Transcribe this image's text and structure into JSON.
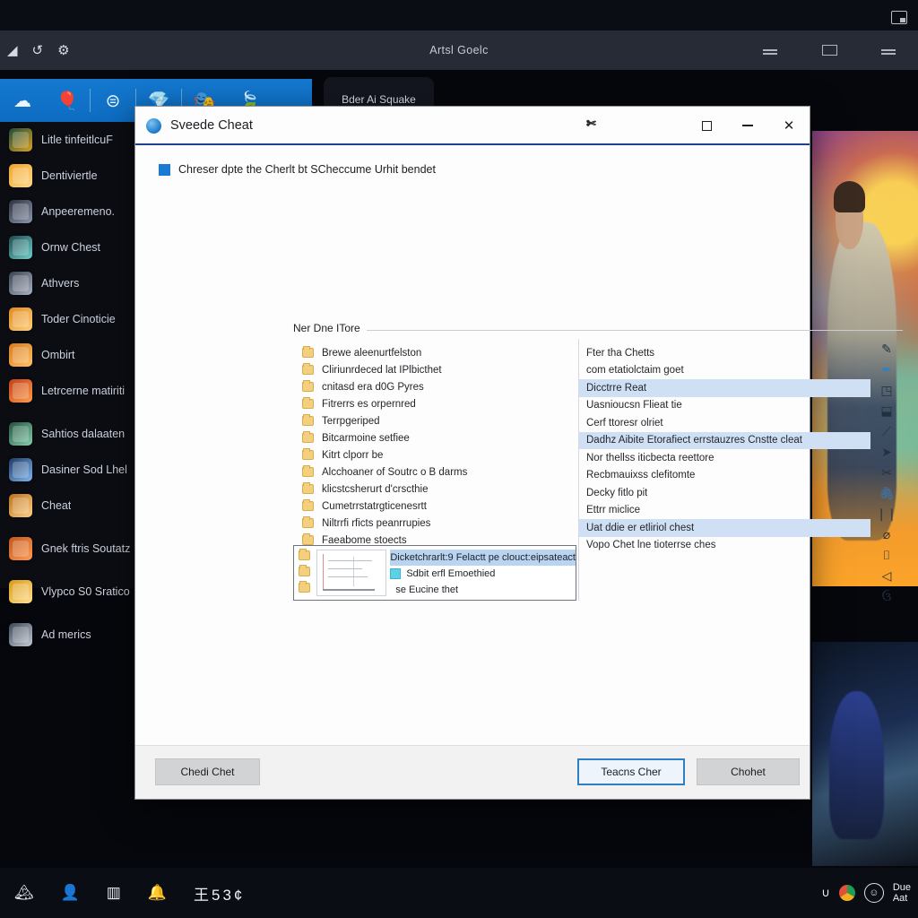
{
  "desktop": {
    "chrome": {
      "title": "Artsl Goelc",
      "left_glyphs": [
        "◢",
        "↺",
        "⚙"
      ],
      "restore_icon": "restore-icon",
      "buttons": [
        "minimize",
        "maximize",
        "close"
      ]
    },
    "ribbon": {
      "icons": [
        "cloud-icon",
        "balloon-icon",
        "stack-icon",
        "gem-icon",
        "mask-icon",
        "leaf-icon"
      ]
    },
    "tooltip": {
      "text": "Bder Ai Squake"
    },
    "sidebar": {
      "items": [
        {
          "label": "Litle tinfeitlcuF",
          "color1": "#1e4b3a",
          "color2": "#d9a21e"
        },
        {
          "label": "Dentiviertle",
          "color1": "#f0a32a",
          "color2": "#ffd98a"
        },
        {
          "label": "Anpeeremeno.",
          "color1": "#2a3040",
          "color2": "#8d97ab"
        },
        {
          "label": "Ornw Chest",
          "color1": "#1d4a4c",
          "color2": "#6fd0cd"
        },
        {
          "label": "Athvers",
          "color1": "#39424f",
          "color2": "#aab3c1"
        },
        {
          "label": "Toder Cinoticie",
          "color1": "#e08a1e",
          "color2": "#ffcf7c"
        },
        {
          "label": "Ombirt",
          "color1": "#d8791b",
          "color2": "#ffc169"
        },
        {
          "label": "Letrcerne matiriti",
          "color1": "#c23f17",
          "color2": "#ff9c4a"
        },
        {
          "label": "Sahtios dalaaten",
          "color1": "#24503f",
          "color2": "#86cfae"
        },
        {
          "label": "Dasiner Sod Lhel",
          "color1": "#1f3a63",
          "color2": "#7fb6ef"
        },
        {
          "label": "Cheat",
          "color1": "#b9711c",
          "color2": "#ffcf86"
        },
        {
          "label": "Gnek ftris Soutatz",
          "color1": "#c2551b",
          "color2": "#ff9c52"
        },
        {
          "label": "Vlypco S0 Sratico",
          "color1": "#d99a16",
          "color2": "#ffe090"
        },
        {
          "label": "Ad merics",
          "color1": "#3c4654",
          "color2": "#c3cad6"
        }
      ]
    }
  },
  "dialog": {
    "title": "Sveede Cheat",
    "help_glyph": "✄",
    "controls": {
      "maximize": "maximize-icon",
      "minimize": "minimize-icon",
      "close": "✕"
    },
    "checkbox": {
      "checked": true,
      "label": "Chreser dpte the Cherlt bt SCheccume Urhit bendet"
    },
    "group": {
      "legend": "Ner Dne ITore"
    },
    "left_list": [
      "Brewe aleenurtfelston",
      "Cliriunrdeced lat IPlbicthet",
      "cnitasd era d0G Pyres",
      "Fitrerrs es orpernred",
      "Terrpgeriped",
      "Bitcarmoine setfiee",
      "Kitrt clporr be",
      "Alcchoaner of Soutrc o B darms",
      "klicstcsherurt d'crscthie",
      "Cumetrrstatrgticenesrtt",
      "Niltrrfi rficts peanrrupies",
      "Faeabome stoects"
    ],
    "inset": {
      "thumbnail": "chart-thumbnail",
      "row_selected": "Dicketchrarlt:9 Felactt pe clouct:eipsateact",
      "row_checkbox": {
        "checked": true,
        "label": "Sdbit erfl Emoethied"
      },
      "row_plain": "se Eucine thet"
    },
    "right_list": [
      {
        "text": "Fter tha Chetts",
        "selected": false
      },
      {
        "text": "com etatiolctaim goet",
        "selected": false
      },
      {
        "text": "Dicctrre Reat",
        "selected": true
      },
      {
        "text": "Uasnioucsn Flieat tie",
        "selected": false
      },
      {
        "text": "Cerf ttoresr olriet",
        "selected": false
      },
      {
        "text": "Dadhz Aibite Etorafiect errstauzres Cnstte cleat",
        "selected": true
      },
      {
        "text": "Nor thellss iticbecta reettore",
        "selected": false
      },
      {
        "text": "Recbmauixss clefitomte",
        "selected": false
      },
      {
        "text": "Decky fitlo pit",
        "selected": false
      },
      {
        "text": "Ettrr miclice",
        "selected": false
      },
      {
        "text": "Uat ddie er etliriol chest",
        "selected": true
      },
      {
        "text": "Vopo Chet lne tioterrse ches",
        "selected": false
      }
    ],
    "tools": [
      {
        "glyph": "✎",
        "highlight": false,
        "name": "pencil-tool-icon"
      },
      {
        "glyph": "✒",
        "highlight": true,
        "name": "pen-tool-icon"
      },
      {
        "glyph": "◳",
        "highlight": false,
        "name": "crop-tool-icon"
      },
      {
        "glyph": "⬓",
        "highlight": false,
        "name": "frame-tool-icon"
      },
      {
        "glyph": "⟋",
        "highlight": false,
        "name": "line-tool-icon"
      },
      {
        "glyph": "➤",
        "highlight": false,
        "name": "arrow-tool-icon"
      },
      {
        "glyph": "✂",
        "highlight": false,
        "name": "scissors-tool-icon"
      },
      {
        "glyph": "🖇",
        "highlight": true,
        "name": "link-tool-icon"
      },
      {
        "glyph": "❘❘",
        "highlight": false,
        "name": "columns-tool-icon"
      },
      {
        "glyph": "⌀",
        "highlight": false,
        "name": "measure-tool-icon"
      },
      {
        "glyph": "⌷",
        "highlight": false,
        "name": "box-tool-icon"
      },
      {
        "glyph": "◁",
        "highlight": false,
        "name": "shape-tool-icon"
      },
      {
        "glyph": "ઉ",
        "highlight": false,
        "name": "lasso-tool-icon"
      }
    ],
    "footer": {
      "check_label": "Chedi Chet",
      "resume_label": "Teacns Cher",
      "cancel_label": "Chohet"
    }
  },
  "taskbar": {
    "icons": [
      "mountain-icon",
      "person-icon",
      "window-icon",
      "bell-icon"
    ],
    "clock": "王53¢",
    "due": {
      "line1": "Due",
      "line2": "Aat"
    },
    "circle_glyph": "☺"
  }
}
